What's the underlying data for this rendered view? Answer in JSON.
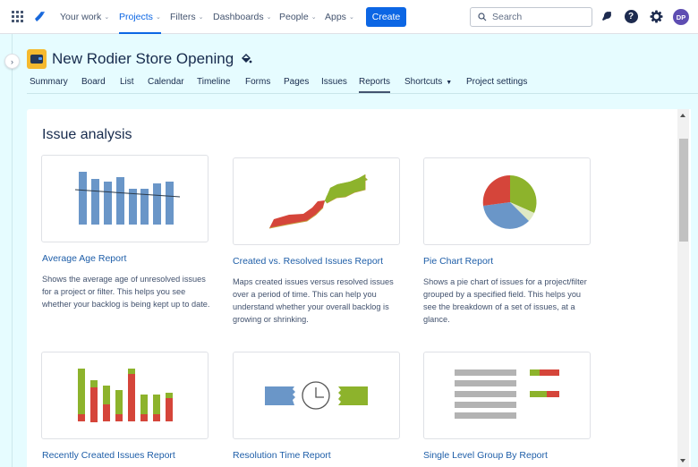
{
  "topnav": {
    "items": [
      {
        "label": "Your work",
        "active": false
      },
      {
        "label": "Projects",
        "active": true
      },
      {
        "label": "Filters",
        "active": false
      },
      {
        "label": "Dashboards",
        "active": false
      },
      {
        "label": "People",
        "active": false
      },
      {
        "label": "Apps",
        "active": false
      }
    ],
    "create_label": "Create",
    "search_placeholder": "Search",
    "avatar_initials": "DP",
    "icons": [
      "app-switcher-icon",
      "jira-logo-icon",
      "search-icon",
      "notifications-icon",
      "help-icon",
      "settings-icon"
    ]
  },
  "project": {
    "title": "New Rodier Store Opening",
    "tabs": [
      {
        "label": "Summary",
        "active": false
      },
      {
        "label": "Board",
        "active": false
      },
      {
        "label": "List",
        "active": false
      },
      {
        "label": "Calendar",
        "active": false
      },
      {
        "label": "Timeline",
        "active": false
      },
      {
        "label": "Forms",
        "active": false
      },
      {
        "label": "Pages",
        "active": false
      },
      {
        "label": "Issues",
        "active": false
      },
      {
        "label": "Reports",
        "active": true
      },
      {
        "label": "Shortcuts",
        "active": false,
        "dropdown": true
      },
      {
        "label": "Project settings",
        "active": false
      }
    ]
  },
  "main": {
    "section_title": "Issue analysis",
    "reports": [
      {
        "title": "Average Age Report",
        "description": "Shows the average age of unresolved issues for a project or filter. This helps you see whether your backlog is being kept up to date.",
        "thumbnail": "average-age-bar-chart"
      },
      {
        "title": "Created vs. Resolved Issues Report",
        "description": "Maps created issues versus resolved issues over a period of time. This can help you understand whether your overall backlog is growing or shrinking.",
        "thumbnail": "created-vs-resolved-area-chart"
      },
      {
        "title": "Pie Chart Report",
        "description": "Shows a pie chart of issues for a project/filter grouped by a specified field. This helps you see the breakdown of a set of issues, at a glance.",
        "thumbnail": "pie-chart"
      },
      {
        "title": "Recently Created Issues Report",
        "description": "",
        "thumbnail": "recently-created-stacked-bar-chart"
      },
      {
        "title": "Resolution Time Report",
        "description": "",
        "thumbnail": "resolution-time-clock"
      },
      {
        "title": "Single Level Group By Report",
        "description": "",
        "thumbnail": "single-level-group-list"
      }
    ]
  },
  "colors": {
    "accent": "#0c66e4",
    "chart_blue": "#6a96c8",
    "chart_green": "#8db32c",
    "chart_red": "#d5453a",
    "chart_pale_green": "#dfe9c4",
    "chart_gray": "#b3b3b3",
    "page_bg": "#e6fcff"
  }
}
